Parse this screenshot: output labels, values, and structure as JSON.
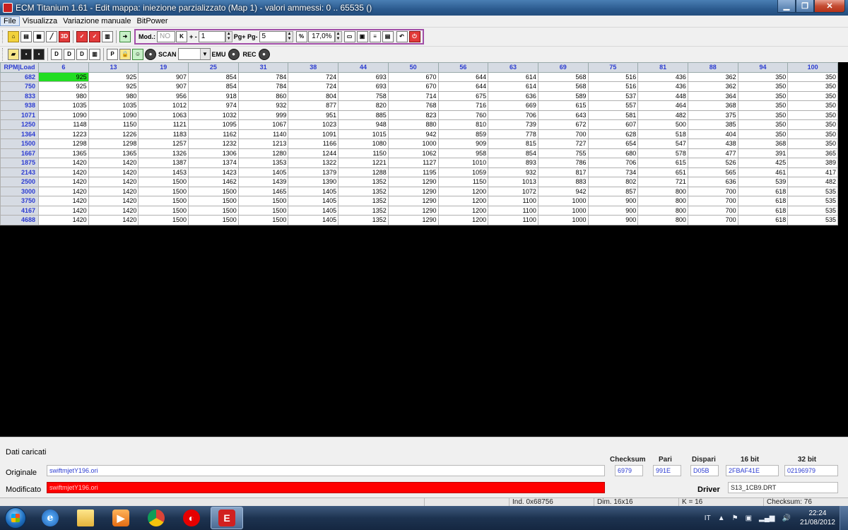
{
  "window": {
    "title": "ECM Titanium 1.61 - Edit mappa: iniezione parzializzato (Map 1) - valori ammessi: 0 .. 65535 ()",
    "minimize_glyph": "▁",
    "restore_glyph": "❐",
    "close_glyph": "✕"
  },
  "menu": {
    "items": [
      "File",
      "Visualizza",
      "Variazione manuale",
      "BitPower"
    ]
  },
  "toolbar": {
    "mod_label": "Mod.:",
    "mod_value": "NO",
    "plusminus_label": "+ -",
    "plusminus_value": "1",
    "page_label": "Pg+ Pg-",
    "page_value": "5",
    "percent_value": "17,0%",
    "scan_label": "SCAN",
    "scan_value": "",
    "emu_label": "EMU",
    "rec_label": "REC",
    "icons": [
      "open-folder-icon",
      "save-icon",
      "save-as-icon"
    ]
  },
  "grid": {
    "corner": "RPM|Load",
    "load_axis": [
      "6",
      "13",
      "19",
      "25",
      "31",
      "38",
      "44",
      "50",
      "56",
      "63",
      "69",
      "75",
      "81",
      "88",
      "94",
      "100"
    ],
    "rpm_axis": [
      "682",
      "750",
      "833",
      "938",
      "1071",
      "1250",
      "1364",
      "1500",
      "1667",
      "1875",
      "2143",
      "2500",
      "3000",
      "3750",
      "4167",
      "4688"
    ],
    "rows": [
      [
        "925",
        "925",
        "907",
        "854",
        "784",
        "724",
        "693",
        "670",
        "644",
        "614",
        "568",
        "516",
        "436",
        "362",
        "350",
        "350"
      ],
      [
        "925",
        "925",
        "907",
        "854",
        "784",
        "724",
        "693",
        "670",
        "644",
        "614",
        "568",
        "516",
        "436",
        "362",
        "350",
        "350"
      ],
      [
        "980",
        "980",
        "956",
        "918",
        "860",
        "804",
        "758",
        "714",
        "675",
        "636",
        "589",
        "537",
        "448",
        "364",
        "350",
        "350"
      ],
      [
        "1035",
        "1035",
        "1012",
        "974",
        "932",
        "877",
        "820",
        "768",
        "716",
        "669",
        "615",
        "557",
        "464",
        "368",
        "350",
        "350"
      ],
      [
        "1090",
        "1090",
        "1063",
        "1032",
        "999",
        "951",
        "885",
        "823",
        "760",
        "706",
        "643",
        "581",
        "482",
        "375",
        "350",
        "350"
      ],
      [
        "1148",
        "1150",
        "1121",
        "1095",
        "1067",
        "1023",
        "948",
        "880",
        "810",
        "739",
        "672",
        "607",
        "500",
        "385",
        "350",
        "350"
      ],
      [
        "1223",
        "1226",
        "1183",
        "1162",
        "1140",
        "1091",
        "1015",
        "942",
        "859",
        "778",
        "700",
        "628",
        "518",
        "404",
        "350",
        "350"
      ],
      [
        "1298",
        "1298",
        "1257",
        "1232",
        "1213",
        "1166",
        "1080",
        "1000",
        "909",
        "815",
        "727",
        "654",
        "547",
        "438",
        "368",
        "350"
      ],
      [
        "1365",
        "1365",
        "1326",
        "1306",
        "1280",
        "1244",
        "1150",
        "1062",
        "958",
        "854",
        "755",
        "680",
        "578",
        "477",
        "391",
        "365"
      ],
      [
        "1420",
        "1420",
        "1387",
        "1374",
        "1353",
        "1322",
        "1221",
        "1127",
        "1010",
        "893",
        "786",
        "706",
        "615",
        "526",
        "425",
        "389"
      ],
      [
        "1420",
        "1420",
        "1453",
        "1423",
        "1405",
        "1379",
        "1288",
        "1195",
        "1059",
        "932",
        "817",
        "734",
        "651",
        "565",
        "461",
        "417"
      ],
      [
        "1420",
        "1420",
        "1500",
        "1462",
        "1439",
        "1390",
        "1352",
        "1290",
        "1150",
        "1013",
        "883",
        "802",
        "721",
        "636",
        "539",
        "482"
      ],
      [
        "1420",
        "1420",
        "1500",
        "1500",
        "1465",
        "1405",
        "1352",
        "1290",
        "1200",
        "1072",
        "942",
        "857",
        "800",
        "700",
        "618",
        "535"
      ],
      [
        "1420",
        "1420",
        "1500",
        "1500",
        "1500",
        "1405",
        "1352",
        "1290",
        "1200",
        "1100",
        "1000",
        "900",
        "800",
        "700",
        "618",
        "535"
      ],
      [
        "1420",
        "1420",
        "1500",
        "1500",
        "1500",
        "1405",
        "1352",
        "1290",
        "1200",
        "1100",
        "1000",
        "900",
        "800",
        "700",
        "618",
        "535"
      ],
      [
        "1420",
        "1420",
        "1500",
        "1500",
        "1500",
        "1405",
        "1352",
        "1290",
        "1200",
        "1100",
        "1000",
        "900",
        "800",
        "700",
        "618",
        "535"
      ]
    ],
    "selected_cell": {
      "row": 0,
      "col": 0
    },
    "selected_color": "#22dd22",
    "axis_color": "#2b3bd1"
  },
  "loaded": {
    "title": "Dati caricati",
    "original_label": "Originale",
    "original_file": "swiftmjetY196.ori",
    "modified_label": "Modificato",
    "modified_file": "swiftmjetY196.ori",
    "modified_color": "#ff0000",
    "checksum_label": "Checksum",
    "checksum_value": "6979",
    "pari_label": "Pari",
    "pari_value": "991E",
    "dispari_label": "Dispari",
    "dispari_value": "D05B",
    "bit16_label": "16 bit",
    "bit16_value": "2FBAF41E",
    "bit32_label": "32 bit",
    "bit32_value": "02196979",
    "driver_label": "Driver",
    "driver_value": "S13_1CB9.DRT"
  },
  "status": {
    "ind": "Ind. 0x68756",
    "dim": "Dim. 16x16",
    "k": "K = 16",
    "checksum": "Checksum: 76"
  },
  "taskbar": {
    "apps": [
      "internet-explorer-icon",
      "folder-icon",
      "media-player-icon",
      "chrome-icon",
      "vodafone-icon",
      "ecm-titanium-icon"
    ],
    "lang": "IT",
    "time": "22:24",
    "date": "21/08/2012"
  }
}
